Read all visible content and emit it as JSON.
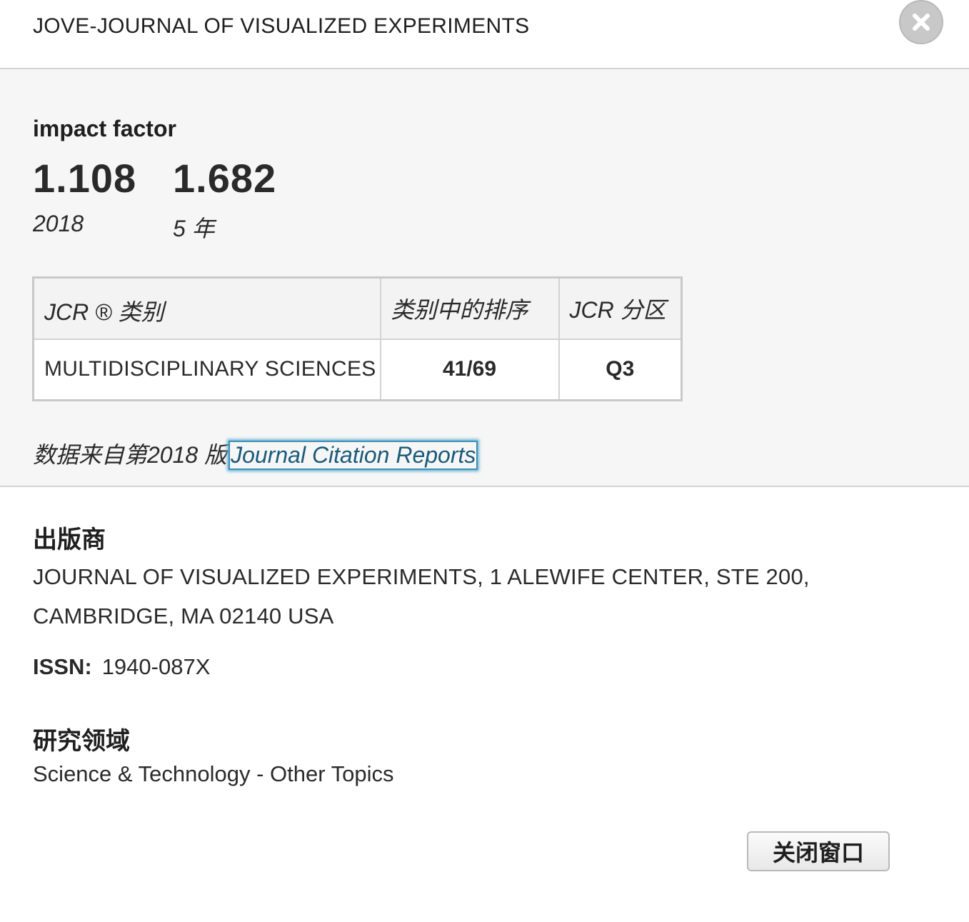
{
  "header": {
    "title": "JOVE-JOURNAL OF VISUALIZED EXPERIMENTS",
    "close_icon": "close-icon"
  },
  "impact": {
    "label": "impact factor",
    "values": [
      {
        "value": "1.108",
        "caption": "2018"
      },
      {
        "value": "1.682",
        "caption": "5 年"
      }
    ]
  },
  "jcr": {
    "headers": {
      "category": "JCR ® 类别",
      "rank": "类别中的排序",
      "quartile": "JCR 分区"
    },
    "rows": [
      {
        "category": "MULTIDISCIPLINARY SCIENCES",
        "rank": "41/69",
        "quartile": "Q3"
      }
    ]
  },
  "source": {
    "prefix": "数据来自第2018 版",
    "link": "Journal Citation Reports"
  },
  "publisher": {
    "heading": "出版商",
    "text": "JOURNAL OF VISUALIZED EXPERIMENTS, 1 ALEWIFE CENTER, STE 200, CAMBRIDGE, MA 02140 USA"
  },
  "issn": {
    "label": "ISSN:",
    "value": "1940-087X"
  },
  "research": {
    "heading": "研究领域",
    "text": "Science & Technology - Other Topics"
  },
  "footer": {
    "close_label": "关闭窗口"
  }
}
